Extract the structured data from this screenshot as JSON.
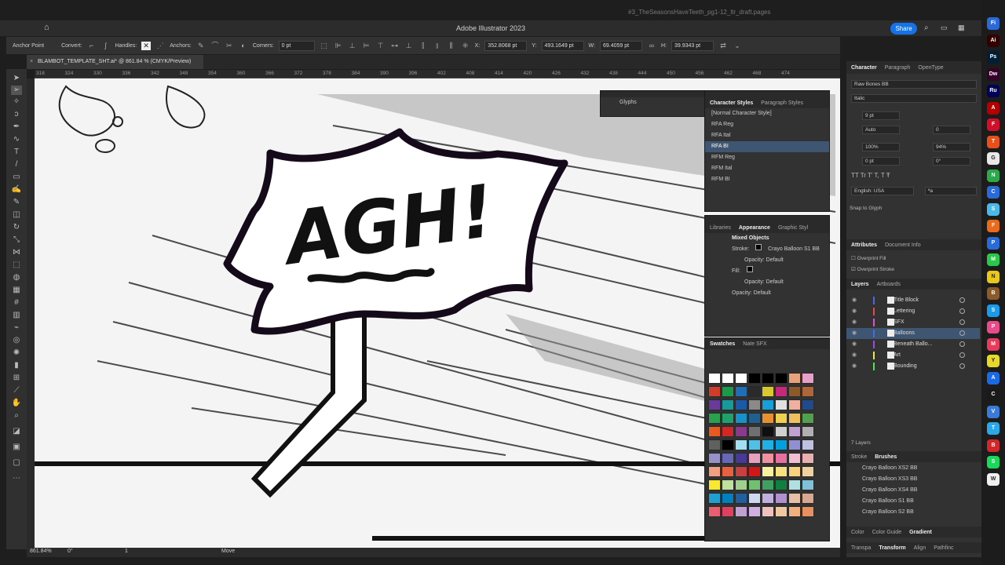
{
  "window": {
    "app_title": "Adobe Illustrator 2023",
    "background_doc": "#3_TheSeasonsHaveTeeth_pg1-12_ltr_draft.pages",
    "share_label": "Share"
  },
  "control_bar": {
    "anchor_point": "Anchor Point",
    "convert": "Convert:",
    "handles": "Handles:",
    "anchors": "Anchors:",
    "corners": "Corners:",
    "corners_value": "0 pt",
    "x_label": "X:",
    "x_value": "352.8068 pt",
    "y_label": "Y:",
    "y_value": "493.1649 pt",
    "w_label": "W:",
    "w_value": "69.4059 pt",
    "h_label": "H:",
    "h_value": "39.9343 pt"
  },
  "doc_tab": {
    "label": "BLAMBOT_TEMPLATE_SHT.ai* @ 861.84 % (CMYK/Preview)"
  },
  "ruler_ticks": [
    "318",
    "324",
    "330",
    "336",
    "342",
    "348",
    "354",
    "360",
    "366",
    "372",
    "378",
    "384",
    "390",
    "396",
    "402",
    "408",
    "414",
    "420",
    "426",
    "432",
    "438",
    "444",
    "450",
    "456",
    "462",
    "468",
    "474"
  ],
  "canvas": {
    "sfx_text": "AGH!"
  },
  "status_bar": {
    "zoom": "861.84%",
    "rotation": "0°",
    "artboard": "1",
    "tool": "Move"
  },
  "glyphs_panel": {
    "title": "Glyphs"
  },
  "char_styles_panel": {
    "tabs": [
      "Character Styles",
      "Paragraph Styles"
    ],
    "items": [
      "[Normal Character Style]",
      "RFA Reg",
      "RFA Ital",
      "RFA BI",
      "RFM Reg",
      "RFM Ital",
      "RFM BI"
    ],
    "selected_index": 3
  },
  "appearance_panel": {
    "tabs": [
      "Libraries",
      "Appearance",
      "Graphic Styl"
    ],
    "object": "Mixed Objects",
    "stroke_label": "Stroke:",
    "stroke_value": "Crayo Balloon S1 BB",
    "opacity_label": "Opacity:",
    "opacity_value": "Default",
    "fill_label": "Fill:",
    "fill_opacity": "Opacity: Default",
    "opacity_row": "Opacity: Default"
  },
  "swatches_panel": {
    "tabs": [
      "Swatches",
      "Nate SFX"
    ],
    "colors": [
      "#ffffff",
      "#ffffff",
      "#ffffff",
      "#000000",
      "#000000",
      "#000000",
      "#e8a27a",
      "#e8a0c8",
      "#d23c2a",
      "#1a9a4a",
      "#1e6fb8",
      "#2a2a2a",
      "#d8c82a",
      "#c8287a",
      "#8c5a2a",
      "#b0663a",
      "#6a3a9a",
      "#169a9a",
      "#1a5aa8",
      "#8a8a8a",
      "#17a0d8",
      "#e0e0e0",
      "#f0b0a0",
      "#204a8a",
      "#2aa050",
      "#20a06a",
      "#1890c8",
      "#206090",
      "#e89030",
      "#f0d050",
      "#f0c060",
      "#50a050",
      "#e85a20",
      "#d02828",
      "#8a3a8a",
      "#707070",
      "#101010",
      "#d0d0d0",
      "#c0a0d0",
      "#b0b0b0",
      "#606060",
      "#000000",
      "#a0e0f0",
      "#50c0e8",
      "#20b0e8",
      "#00a0e0",
      "#9090d0",
      "#c0c0e0",
      "#9890c8",
      "#6868b8",
      "#483898",
      "#e8a0c0",
      "#f090a0",
      "#e870a0",
      "#f0c0d0",
      "#e8b0b0",
      "#f0a080",
      "#e86040",
      "#c84040",
      "#d01818",
      "#f8f0a0",
      "#f8e080",
      "#f8d080",
      "#f0d0a0",
      "#f8e830",
      "#c0e0a0",
      "#a0d090",
      "#70c070",
      "#40a060",
      "#108040",
      "#b0e0e0",
      "#80c0d8",
      "#20a0d0",
      "#0080c0",
      "#2060a0",
      "#d0d8f0",
      "#c0b0e0",
      "#b090d0",
      "#e8c0a8",
      "#d8a890",
      "#e86070",
      "#e04060",
      "#c0a0d0",
      "#d0b0e0",
      "#f0c0c0",
      "#f0c8a0",
      "#f0b080",
      "#e89060"
    ]
  },
  "right_dock": {
    "char_tabs": [
      "Character",
      "Paragraph",
      "OpenType"
    ],
    "font_name": "Raw Bones BB",
    "font_style": "Italic",
    "size": "9 pt",
    "leading": "Auto",
    "scale_h": "100%",
    "scale_v": "94%",
    "baseline": "0 pt",
    "rotation": "0°",
    "tracking": "0",
    "language": "English: USA",
    "aa": "ªa",
    "snap_to_glyph": "Snap to Glyph",
    "attr_tabs": [
      "Attributes",
      "Document Info"
    ],
    "overprint_fill": "Overprint Fill",
    "overprint_stroke": "Overprint Stroke",
    "layers_tabs": [
      "Layers",
      "Artboards"
    ],
    "layers": [
      {
        "name": "Title Block",
        "color": "#4a6ae8"
      },
      {
        "name": "Lettering",
        "color": "#e84a4a"
      },
      {
        "name": "SFX",
        "color": "#e84ad0"
      },
      {
        "name": "Balloons",
        "color": "#4a6ae8"
      },
      {
        "name": "Beneath Ballo...",
        "color": "#9a4ae8"
      },
      {
        "name": "Art",
        "color": "#e8e84a"
      },
      {
        "name": "Bounding",
        "color": "#4ae84a"
      }
    ],
    "layers_count": "7 Layers",
    "brush_tabs": [
      "Stroke",
      "Brushes"
    ],
    "brushes": [
      "Crayo Balloon XS2 BB",
      "Crayo Balloon XS3 BB",
      "Crayo Balloon XS4 BB",
      "Crayo Balloon S1 BB",
      "Crayo Balloon S2 BB"
    ],
    "bottom_tabs1": [
      "Color",
      "Color Guide",
      "Gradient"
    ],
    "bottom_tabs2": [
      "Transpa",
      "Transform",
      "Align",
      "Pathfinc"
    ]
  },
  "dock_apps": [
    {
      "label": "Fi",
      "color": "#2a6ad8"
    },
    {
      "label": "Ai",
      "color": "#330000"
    },
    {
      "label": "Ps",
      "color": "#001e36"
    },
    {
      "label": "Dw",
      "color": "#35002a"
    },
    {
      "label": "Ru",
      "color": "#00005b"
    },
    {
      "label": "A",
      "color": "#b40000"
    },
    {
      "label": "F",
      "color": "#d0102a"
    },
    {
      "label": "T",
      "color": "#e8501a"
    },
    {
      "label": "G",
      "color": "#e8e8e8"
    },
    {
      "label": "N",
      "color": "#2aa84a"
    },
    {
      "label": "C",
      "color": "#2a6ad8"
    },
    {
      "label": "S",
      "color": "#4ab8e8"
    },
    {
      "label": "F",
      "color": "#e86a1a"
    },
    {
      "label": "P",
      "color": "#2a6ad8"
    },
    {
      "label": "M",
      "color": "#2ac84a"
    },
    {
      "label": "N",
      "color": "#e8c81a"
    },
    {
      "label": "B",
      "color": "#8a5a2a"
    },
    {
      "label": "S",
      "color": "#1a9ae8"
    },
    {
      "label": "P",
      "color": "#e84a8a"
    },
    {
      "label": "M",
      "color": "#e83a5a"
    },
    {
      "label": "Y",
      "color": "#e8d82a"
    },
    {
      "label": "A",
      "color": "#1a6ae8"
    },
    {
      "label": "C",
      "color": "#1a1a1a"
    },
    {
      "label": "V",
      "color": "#3a7ad8"
    },
    {
      "label": "T",
      "color": "#2aa8e8"
    },
    {
      "label": "B",
      "color": "#d0282a"
    },
    {
      "label": "S",
      "color": "#1ad85a"
    },
    {
      "label": "W",
      "color": "#f0f0f0"
    }
  ]
}
